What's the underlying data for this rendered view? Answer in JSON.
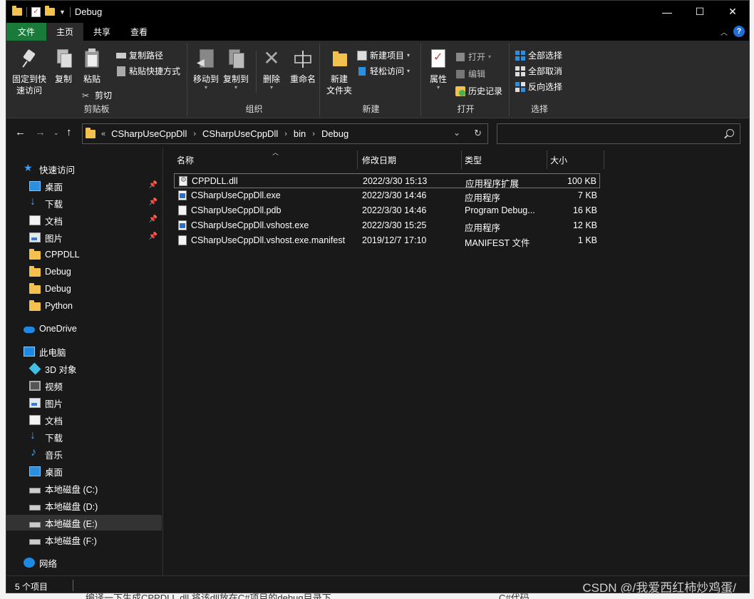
{
  "window": {
    "title": "Debug",
    "minimize": "—",
    "maximize": "☐",
    "close": "✕"
  },
  "ribbon_tabs": {
    "file": "文件",
    "home": "主页",
    "share": "共享",
    "view": "查看"
  },
  "ribbon": {
    "clipboard": {
      "label": "剪贴板",
      "pin": "固定到快速访问",
      "pin_line1": "固定到快",
      "pin_line2": "速访问",
      "copy": "复制",
      "paste": "粘贴",
      "copy_path": "复制路径",
      "paste_shortcut": "粘贴快捷方式",
      "cut": "剪切"
    },
    "organize": {
      "label": "组织",
      "move_to": "移动到",
      "copy_to": "复制到",
      "delete": "删除",
      "rename": "重命名"
    },
    "new": {
      "label": "新建",
      "new_folder_line1": "新建",
      "new_folder_line2": "文件夹",
      "new_item": "新建项目",
      "easy_access": "轻松访问"
    },
    "open": {
      "label": "打开",
      "properties": "属性",
      "open": "打开",
      "edit": "编辑",
      "history": "历史记录"
    },
    "select": {
      "label": "选择",
      "select_all": "全部选择",
      "select_none": "全部取消",
      "invert": "反向选择"
    }
  },
  "address": {
    "prefix": "«",
    "crumbs": [
      "CSharpUseCppDll",
      "CSharpUseCppDll",
      "bin",
      "Debug"
    ],
    "search_placeholder": ""
  },
  "nav": {
    "quick_access": "快速访问",
    "items": [
      {
        "label": "桌面",
        "pinned": true
      },
      {
        "label": "下载",
        "pinned": true
      },
      {
        "label": "文档",
        "pinned": true
      },
      {
        "label": "图片",
        "pinned": true
      },
      {
        "label": "CPPDLL"
      },
      {
        "label": "Debug"
      },
      {
        "label": "Debug"
      },
      {
        "label": "Python"
      }
    ],
    "onedrive": "OneDrive",
    "this_pc": "此电脑",
    "pc_items": [
      "3D 对象",
      "视频",
      "图片",
      "文档",
      "下载",
      "音乐",
      "桌面",
      "本地磁盘 (C:)",
      "本地磁盘 (D:)",
      "本地磁盘 (E:)",
      "本地磁盘 (F:)"
    ],
    "network": "网络"
  },
  "columns": {
    "name": "名称",
    "date": "修改日期",
    "type": "类型",
    "size": "大小"
  },
  "files": [
    {
      "name": "CPPDLL.dll",
      "date": "2022/3/30 15:13",
      "type": "应用程序扩展",
      "size": "100 KB",
      "icon": "dll-icon"
    },
    {
      "name": "CSharpUseCppDll.exe",
      "date": "2022/3/30 14:46",
      "type": "应用程序",
      "size": "7 KB",
      "icon": "exe-icon"
    },
    {
      "name": "CSharpUseCppDll.pdb",
      "date": "2022/3/30 14:46",
      "type": "Program Debug...",
      "size": "16 KB",
      "icon": "file-icon"
    },
    {
      "name": "CSharpUseCppDll.vshost.exe",
      "date": "2022/3/30 15:25",
      "type": "应用程序",
      "size": "12 KB",
      "icon": "exe-icon"
    },
    {
      "name": "CSharpUseCppDll.vshost.exe.manifest",
      "date": "2019/12/7 17:10",
      "type": "MANIFEST 文件",
      "size": "1 KB",
      "icon": "file-icon"
    }
  ],
  "status": {
    "count": "5 个项目"
  },
  "watermark": "CSDN @/我爱西红柿炒鸡蛋/",
  "background": {
    "bottom_left_text": "编译一下生成CPPDLL.dll,将该dll放在C#项目的debug目录下",
    "bottom_right_text": "C#代码"
  },
  "colors": {
    "file_tab": "#1a7a3a",
    "window_bg": "#191919",
    "ribbon_bg": "#2b2b2b",
    "folder": "#f2c14e",
    "accent_blue": "#1e88e5"
  }
}
